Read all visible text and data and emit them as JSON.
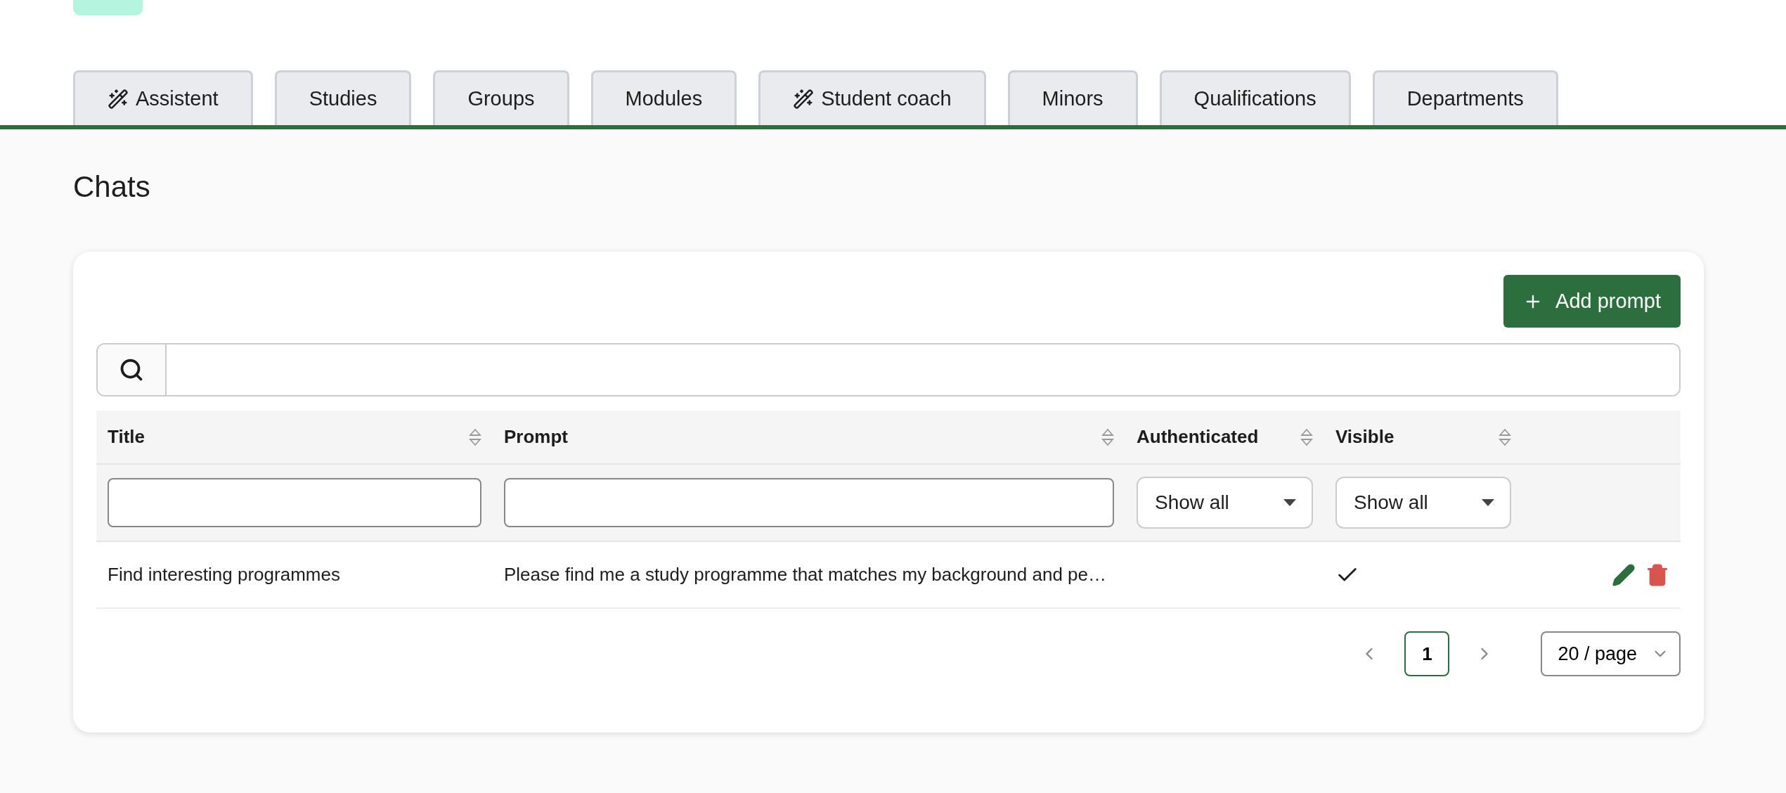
{
  "tabs": [
    {
      "label": "Assistent",
      "kind": "magic",
      "selected": false
    },
    {
      "label": "Studies",
      "kind": "plain",
      "selected": false
    },
    {
      "label": "Groups",
      "kind": "plain",
      "selected": false
    },
    {
      "label": "Modules",
      "kind": "plain",
      "selected": false
    },
    {
      "label": "Student coach",
      "kind": "magic",
      "selected": false
    },
    {
      "label": "Minors",
      "kind": "plain",
      "selected": false
    },
    {
      "label": "Qualifications",
      "kind": "plain",
      "selected": false
    },
    {
      "label": "Departments",
      "kind": "plain",
      "selected": false
    }
  ],
  "heading": "Chats",
  "add_button": "Add prompt",
  "table": {
    "columns": [
      {
        "label": "Title",
        "kind": "text"
      },
      {
        "label": "Prompt",
        "kind": "text"
      },
      {
        "label": "Authenticated",
        "kind": "select",
        "value": "Show all"
      },
      {
        "label": "Visible",
        "kind": "select",
        "value": "Show all"
      }
    ],
    "rows": [
      {
        "title": "Find interesting programmes",
        "prompt": "Please find me a study programme that matches my background and pe…",
        "authenticated": false,
        "visible": true
      }
    ]
  },
  "pagination": {
    "pages": [
      {
        "label": "1",
        "selected": true
      }
    ],
    "page_size": "20 / page"
  }
}
